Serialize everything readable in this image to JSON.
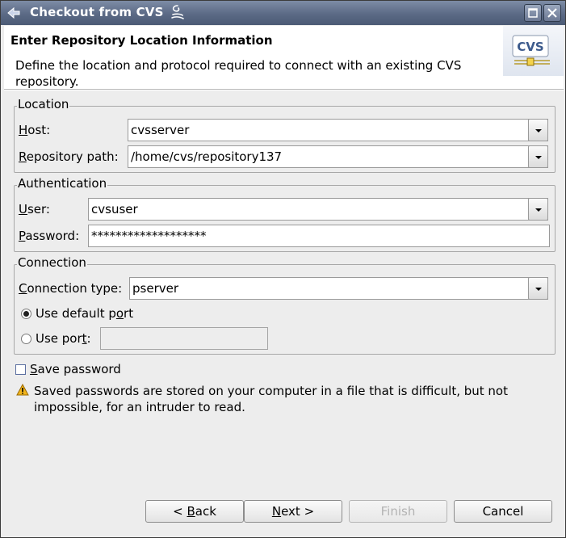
{
  "window": {
    "title": "Checkout from CVS"
  },
  "header": {
    "title": "Enter Repository Location Information",
    "description": "Define the location and protocol required to connect with an existing CVS repository.",
    "logo_text": "CVS"
  },
  "location": {
    "group_label": "Location",
    "host_label_u": "H",
    "host_label_rest": "ost:",
    "host_value": "cvsserver",
    "repo_label_u": "R",
    "repo_label_rest": "epository path:",
    "repo_value": "/home/cvs/repository137"
  },
  "authentication": {
    "group_label": "Authentication",
    "user_label_u": "U",
    "user_label_rest": "ser:",
    "user_value": "cvsuser",
    "password_label_u": "P",
    "password_label_rest": "assword:",
    "password_value": "*******************"
  },
  "connection": {
    "group_label": "Connection",
    "type_label_u": "C",
    "type_label_rest": "onnection type:",
    "type_value": "pserver",
    "default_port_pre": "Use default p",
    "default_port_u": "o",
    "default_port_post": "rt",
    "default_port_selected": true,
    "use_port_pre": "Use por",
    "use_port_u": "t",
    "use_port_post": ":",
    "port_value": ""
  },
  "save_password": {
    "label_u": "S",
    "label_rest": "ave password",
    "checked": false
  },
  "warning": {
    "text": "Saved passwords are stored on your computer in a file that is difficult, but not impossible, for an intruder to read."
  },
  "buttons": {
    "back_pre": "< ",
    "back_u": "B",
    "back_post": "ack",
    "next_u": "N",
    "next_post": "ext >",
    "finish": "Finish",
    "cancel": "Cancel"
  },
  "colors": {
    "titlebar": "#5b6a85",
    "dialog_bg": "#ededed",
    "warning_icon": "#f2b51c"
  }
}
